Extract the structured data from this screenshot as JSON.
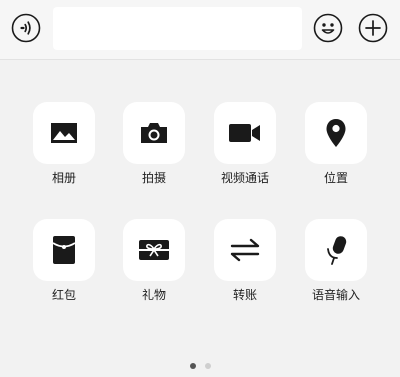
{
  "input_bar": {
    "voice_icon": "voice-wave-icon",
    "message_value": "",
    "emoji_icon": "smiley-icon",
    "more_icon": "plus-circle-icon"
  },
  "panel": {
    "items": [
      {
        "label": "相册",
        "icon": "image-icon"
      },
      {
        "label": "拍摄",
        "icon": "camera-icon"
      },
      {
        "label": "视频通话",
        "icon": "video-camera-icon"
      },
      {
        "label": "位置",
        "icon": "location-pin-icon"
      },
      {
        "label": "红包",
        "icon": "red-envelope-icon"
      },
      {
        "label": "礼物",
        "icon": "gift-icon"
      },
      {
        "label": "转账",
        "icon": "transfer-icon"
      },
      {
        "label": "语音输入",
        "icon": "microphone-icon"
      }
    ]
  },
  "pagination": {
    "active_color": "#555555",
    "inactive_color": "#cfcfcf"
  }
}
